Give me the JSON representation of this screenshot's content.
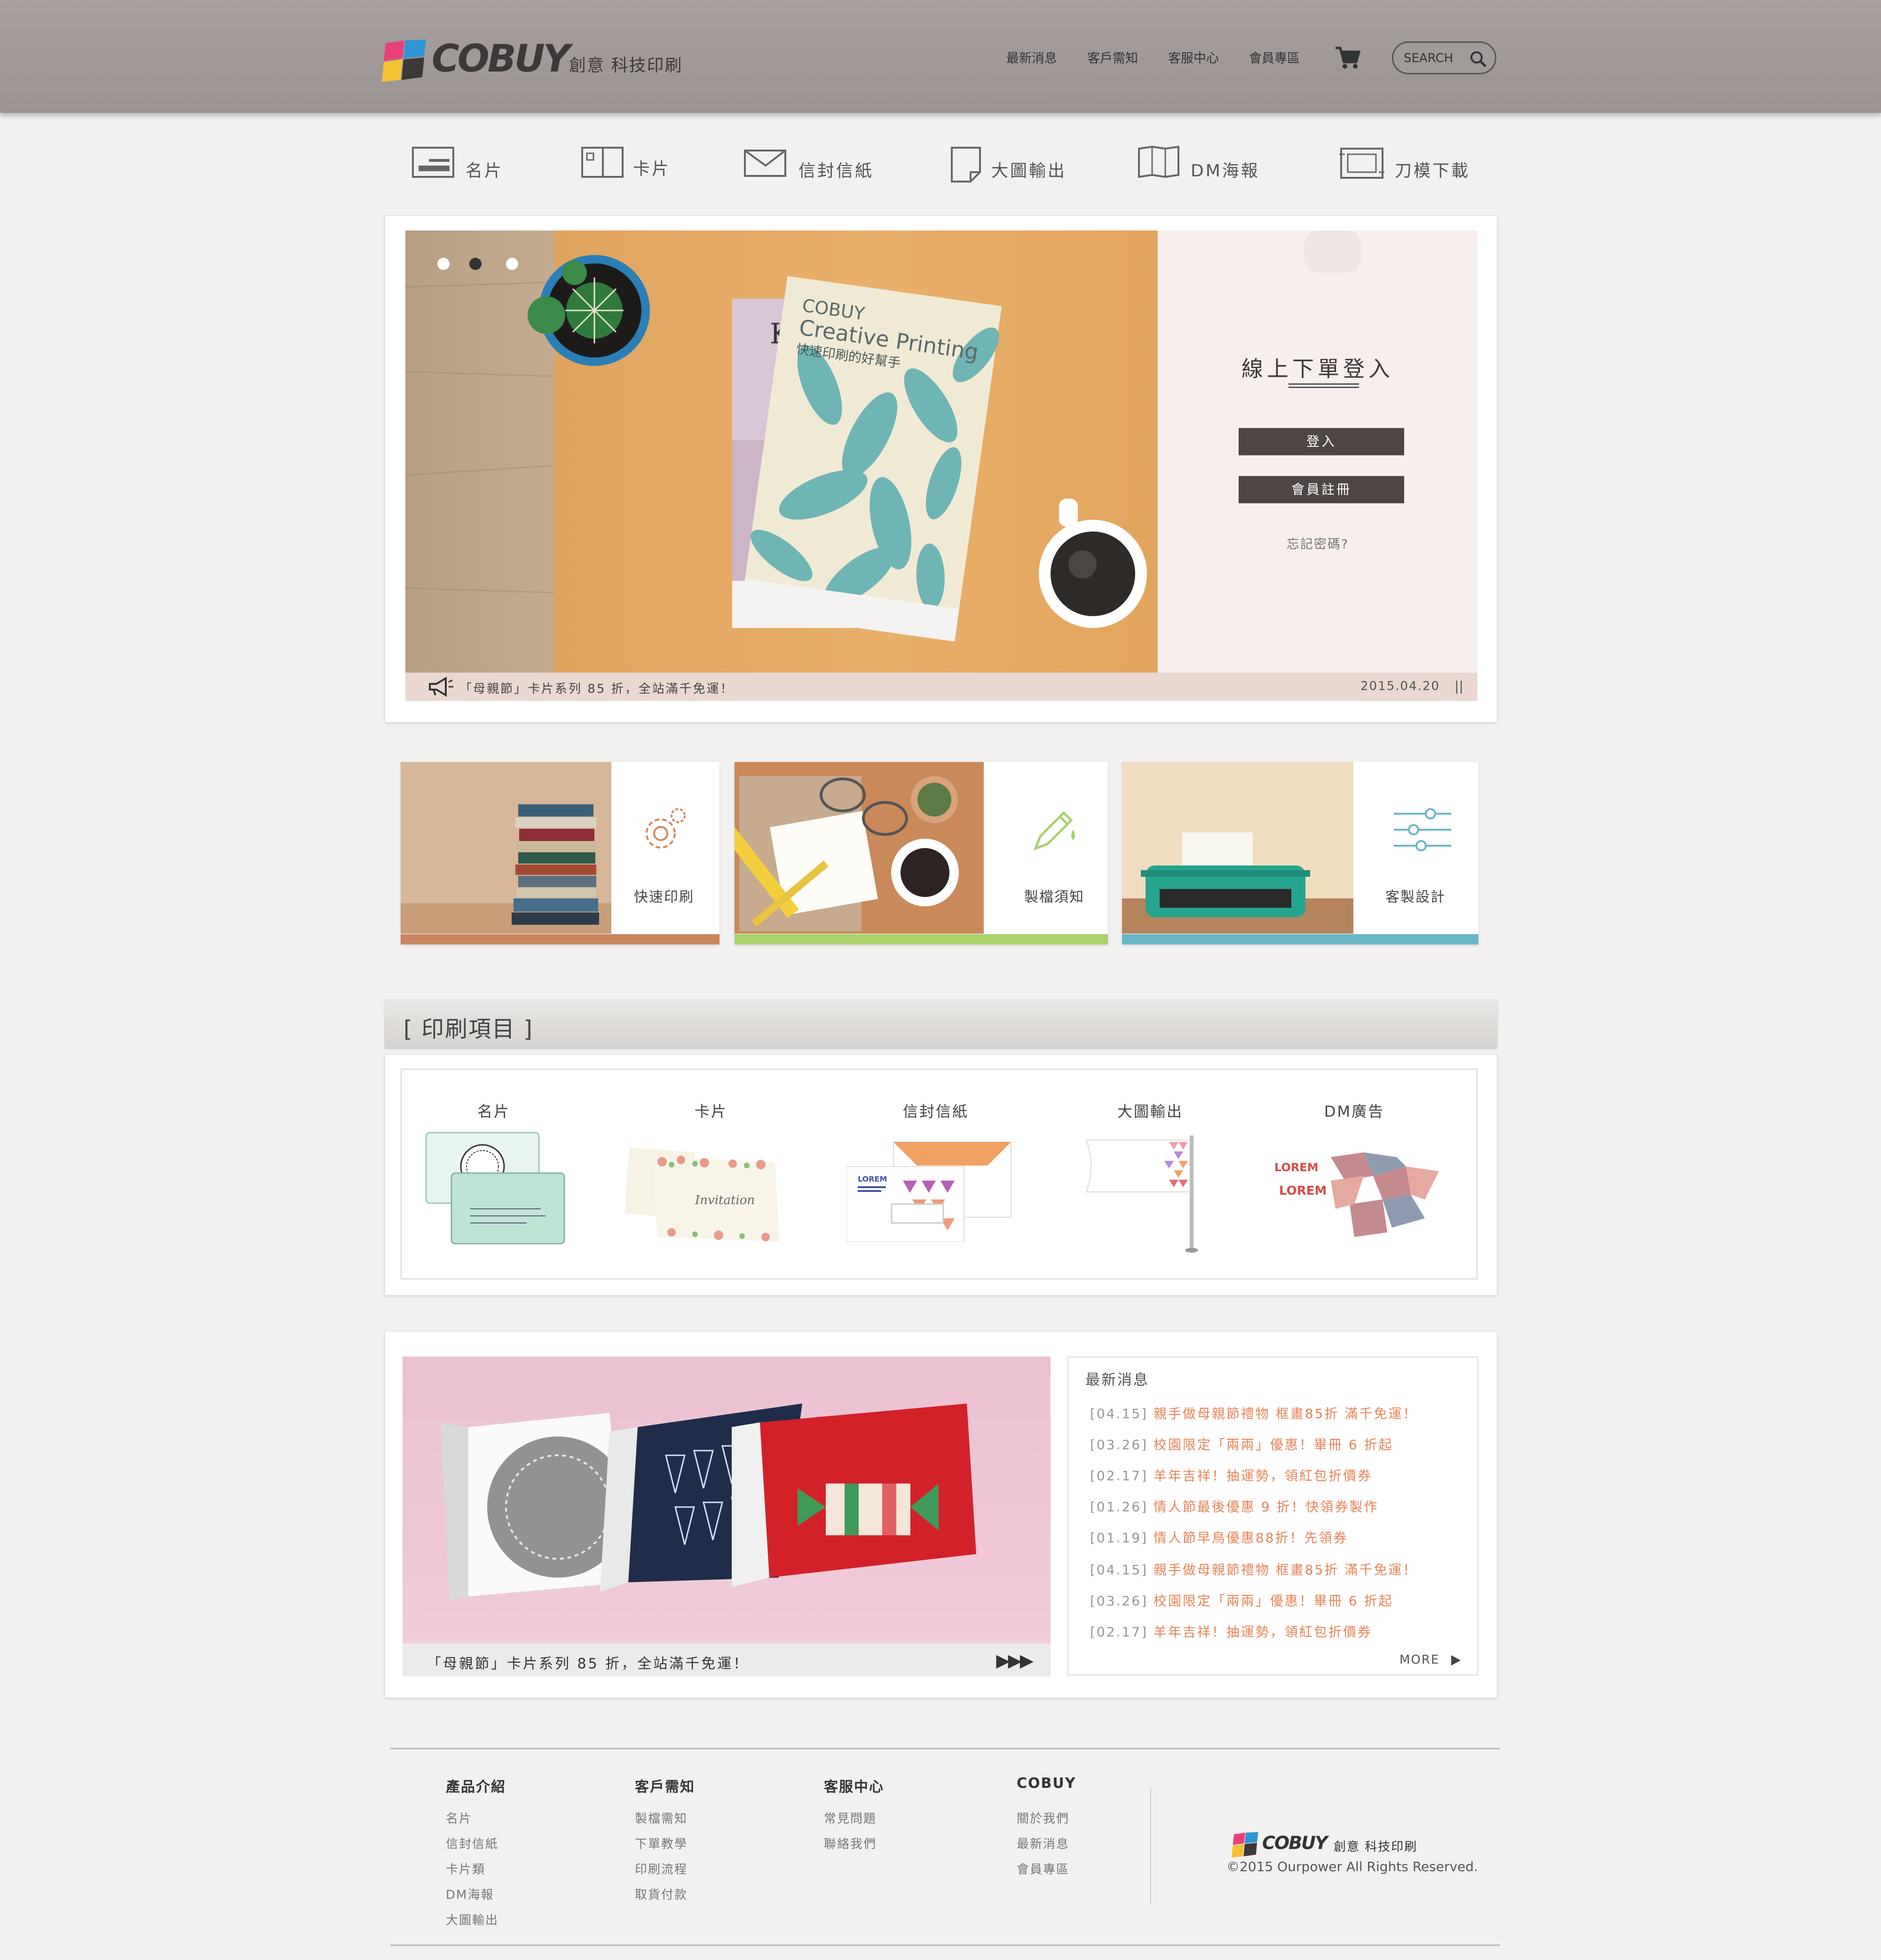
{
  "header": {
    "brand": "COBUY",
    "tagline": "創意 科技印刷",
    "nav": [
      "最新消息",
      "客戶需知",
      "客服中心",
      "會員專區"
    ],
    "search_label": "SEARCH"
  },
  "categories": [
    "名片",
    "卡片",
    "信封信紙",
    "大圖輸出",
    "DM海報",
    "刀模下載"
  ],
  "hero": {
    "book_title_1": "COBUY",
    "book_title_2": "Creative Printing",
    "book_subtitle": "快速印刷的好幫手",
    "book_letter": "K",
    "login_title": "線上下單登入",
    "login_button": "登入",
    "register_button": "會員註冊",
    "forgot_password": "忘記密碼?",
    "announcement": "「母親節」卡片系列 85 折，全站滿千免運！",
    "announcement_date": "2015.04.20",
    "pause_symbol": "||"
  },
  "features": [
    "快速印刷",
    "製檔須知",
    "客製設計"
  ],
  "print_items": {
    "title": "[ 印刷項目 ]",
    "items": [
      "名片",
      "卡片",
      "信封信紙",
      "大圖輸出",
      "DM廣告"
    ],
    "sample_text": {
      "lorem": "LOREM",
      "invitation": "Invitation"
    }
  },
  "promo": {
    "caption": "「母親節」卡片系列 85 折，全站滿千免運！",
    "arrows": "▶▶▶"
  },
  "news": {
    "title": "最新消息",
    "items": [
      {
        "date": "[04.15]",
        "text": "親手做母親節禮物 框畫85折 滿千免運！"
      },
      {
        "date": "[03.26]",
        "text": "校園限定「兩兩」優惠！畢冊 6 折起"
      },
      {
        "date": "[02.17]",
        "text": "羊年吉祥！抽運勢，領紅包折價券"
      },
      {
        "date": "[01.26]",
        "text": "情人節最後優惠 9 折！快領券製作"
      },
      {
        "date": "[01.19]",
        "text": "情人節早鳥優惠88折！先領券"
      },
      {
        "date": "[04.15]",
        "text": "親手做母親節禮物 框畫85折 滿千免運！"
      },
      {
        "date": "[03.26]",
        "text": "校園限定「兩兩」優惠！畢冊 6 折起"
      },
      {
        "date": "[02.17]",
        "text": "羊年吉祥！抽運勢，領紅包折價券"
      }
    ],
    "more": "MORE"
  },
  "footer": {
    "columns": [
      {
        "title": "產品介紹",
        "links": [
          "名片",
          "信封信紙",
          "卡片類",
          "DM海報",
          "大圖輸出"
        ]
      },
      {
        "title": "客戶需知",
        "links": [
          "製檔需知",
          "下單教學",
          "印刷流程",
          "取貨付款"
        ]
      },
      {
        "title": "客服中心",
        "links": [
          "常見問題",
          "聯絡我們"
        ]
      },
      {
        "title": "COBUY",
        "links": [
          "關於我們",
          "最新消息",
          "會員專區"
        ]
      }
    ],
    "brand": "COBUY",
    "tagline": "創意 科技印刷",
    "copyright": "©2015 Ourpower All Rights Reserved."
  },
  "colors": {
    "header": "#9f9998",
    "news_link": "#e48457",
    "button_dark": "#4d4645",
    "feature_bar_1": "#c7865e",
    "feature_bar_2": "#a9d26b",
    "feature_bar_3": "#6ab6c9"
  },
  "icons": [
    "cart-icon",
    "search-icon",
    "megaphone-icon",
    "gear-icon",
    "pen-icon",
    "sliders-icon",
    "play-icon"
  ]
}
